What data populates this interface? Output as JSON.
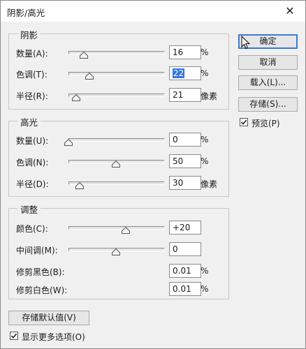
{
  "window": {
    "title": "阴影/高光",
    "close": "✕"
  },
  "shadows": {
    "title": "阴影",
    "rows": [
      {
        "label": "数量(A):",
        "value": "16",
        "unit": "%",
        "level": 0.16
      },
      {
        "label": "色调(T):",
        "value": "22",
        "unit": "%",
        "level": 0.22
      },
      {
        "label": "半径(R):",
        "value": "21",
        "unit": "像素",
        "level": 0.08
      }
    ]
  },
  "highlights": {
    "title": "高光",
    "rows": [
      {
        "label": "数量(U):",
        "value": "0",
        "unit": "%",
        "level": 0.0
      },
      {
        "label": "色调(N):",
        "value": "50",
        "unit": "%",
        "level": 0.5
      },
      {
        "label": "半径(D):",
        "value": "30",
        "unit": "像素",
        "level": 0.12
      }
    ]
  },
  "adjust": {
    "title": "调整",
    "rows": [
      {
        "label": "颜色(C):",
        "value": "+20",
        "unit": "",
        "level": 0.6
      },
      {
        "label": "中间调(M):",
        "value": "0",
        "unit": "",
        "level": 0.5
      },
      {
        "label": "修剪黑色(B):",
        "value": "0.01",
        "unit": "%"
      },
      {
        "label": "修剪白色(W):",
        "value": "0.01",
        "unit": "%"
      }
    ]
  },
  "buttons": {
    "ok": "确定",
    "cancel": "取消",
    "load": "载入(L)...",
    "save": "存储(S)...",
    "save_defaults": "存储默认值(V)"
  },
  "options": {
    "preview": {
      "label": "预览(P)",
      "checked": true
    },
    "more_options": {
      "label": "显示更多选项(O)",
      "checked": true
    }
  },
  "colors": {
    "default_button_border": "#3a7bd5",
    "selection": "#3377dd"
  }
}
